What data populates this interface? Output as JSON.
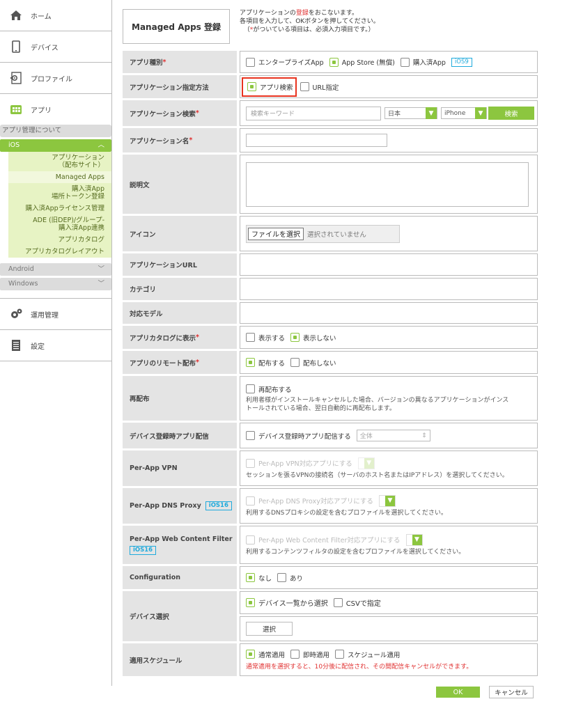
{
  "sidebar": {
    "home": "ホーム",
    "devices": "デバイス",
    "profiles": "プロファイル",
    "apps": "アプリ",
    "about": "アプリ管理について",
    "ios": "iOS",
    "ios_items": [
      "アプリケーション\n（配布サイト）",
      "Managed Apps",
      "購入済App\n場所トークン登録",
      "購入済Appライセンス管理",
      "ADE (旧DEP)/グループ-\n購入済App連携",
      "アプリカタログ",
      "アプリカタログレイアウト"
    ],
    "android": "Android",
    "windows": "Windows",
    "operations": "運用管理",
    "settings": "設定"
  },
  "page_title": "Managed Apps 登録",
  "intro": {
    "line1a": "アプリケーションの",
    "line1b": "登録",
    "line1c": "をおこないます。",
    "line2": "各項目を入力して、OKボタンを押してください。",
    "line3a": "（",
    "line3b": "*",
    "line3c": "がついている項目は、必須入力項目です。）"
  },
  "form": {
    "app_type": {
      "label": "アプリ種別",
      "req": "*",
      "opt1": "エンタープライズApp",
      "opt2": "App Store (無償)",
      "opt3": "購入済App",
      "tag": "iOS9"
    },
    "method": {
      "label": "アプリケーション指定方法",
      "opt1": "アプリ検索",
      "opt2": "URL指定"
    },
    "search": {
      "label": "アプリケーション検索",
      "req": "*",
      "placeholder": "検索キーワード",
      "country": "日本",
      "device": "iPhone",
      "button": "検索"
    },
    "name": {
      "label": "アプリケーション名",
      "req": "*"
    },
    "desc": {
      "label": "説明文"
    },
    "icon": {
      "label": "アイコン",
      "button": "ファイルを選択",
      "status": "選択されていません"
    },
    "url": {
      "label": "アプリケーションURL"
    },
    "category": {
      "label": "カテゴリ"
    },
    "model": {
      "label": "対応モデル"
    },
    "catalog": {
      "label": "アプリカタログに表示",
      "req": "*",
      "opt1": "表示する",
      "opt2": "表示しない"
    },
    "remote": {
      "label": "アプリのリモート配布",
      "req": "*",
      "opt1": "配布する",
      "opt2": "配布しない"
    },
    "redist": {
      "label": "再配布",
      "opt": "再配布する",
      "note1": "利用者様がインストールキャンセルした場合、バージョンの異なるアプリケーションがインス",
      "note2": "トールされている場合、翌日自動的に再配布します。"
    },
    "on_register": {
      "label": "デバイス登録時アプリ配信",
      "opt": "デバイス登録時アプリ配信する",
      "select": "全体"
    },
    "vpn": {
      "label": "Per-App VPN",
      "opt": "Per-App VPN対応アプリにする",
      "note": "セッションを張るVPNの接続名（サーバのホスト名またはIPアドレス）を選択してください。"
    },
    "dns": {
      "label": "Per-App DNS Proxy",
      "tag": "iOS16",
      "opt": "Per-App DNS Proxy対応アプリにする",
      "note": "利用するDNSプロキシの設定を含むプロファイルを選択してください。"
    },
    "webfilter": {
      "label": "Per-App Web Content Filter",
      "tag": "iOS16",
      "opt": "Per-App Web Content Filter対応アプリにする",
      "note": "利用するコンテンツフィルタの設定を含むプロファイルを選択してください。"
    },
    "config": {
      "label": "Configuration",
      "opt1": "なし",
      "opt2": "あり"
    },
    "device_sel": {
      "label": "デバイス選択",
      "opt1": "デバイス一覧から選択",
      "opt2": "CSVで指定",
      "button": "選択"
    },
    "schedule": {
      "label": "適用スケジュール",
      "opt1": "通常適用",
      "opt2": "即時適用",
      "opt3": "スケジュール適用",
      "warn": "通常適用を選択すると、10分後に配信され、その間配信キャンセルができます。"
    }
  },
  "ok": "OK",
  "cancel": "キャンセル",
  "colors": {
    "accent": "#8cc63f",
    "required": "#e03030",
    "highlight": "#e8321e",
    "tag": "#1eaadc"
  }
}
